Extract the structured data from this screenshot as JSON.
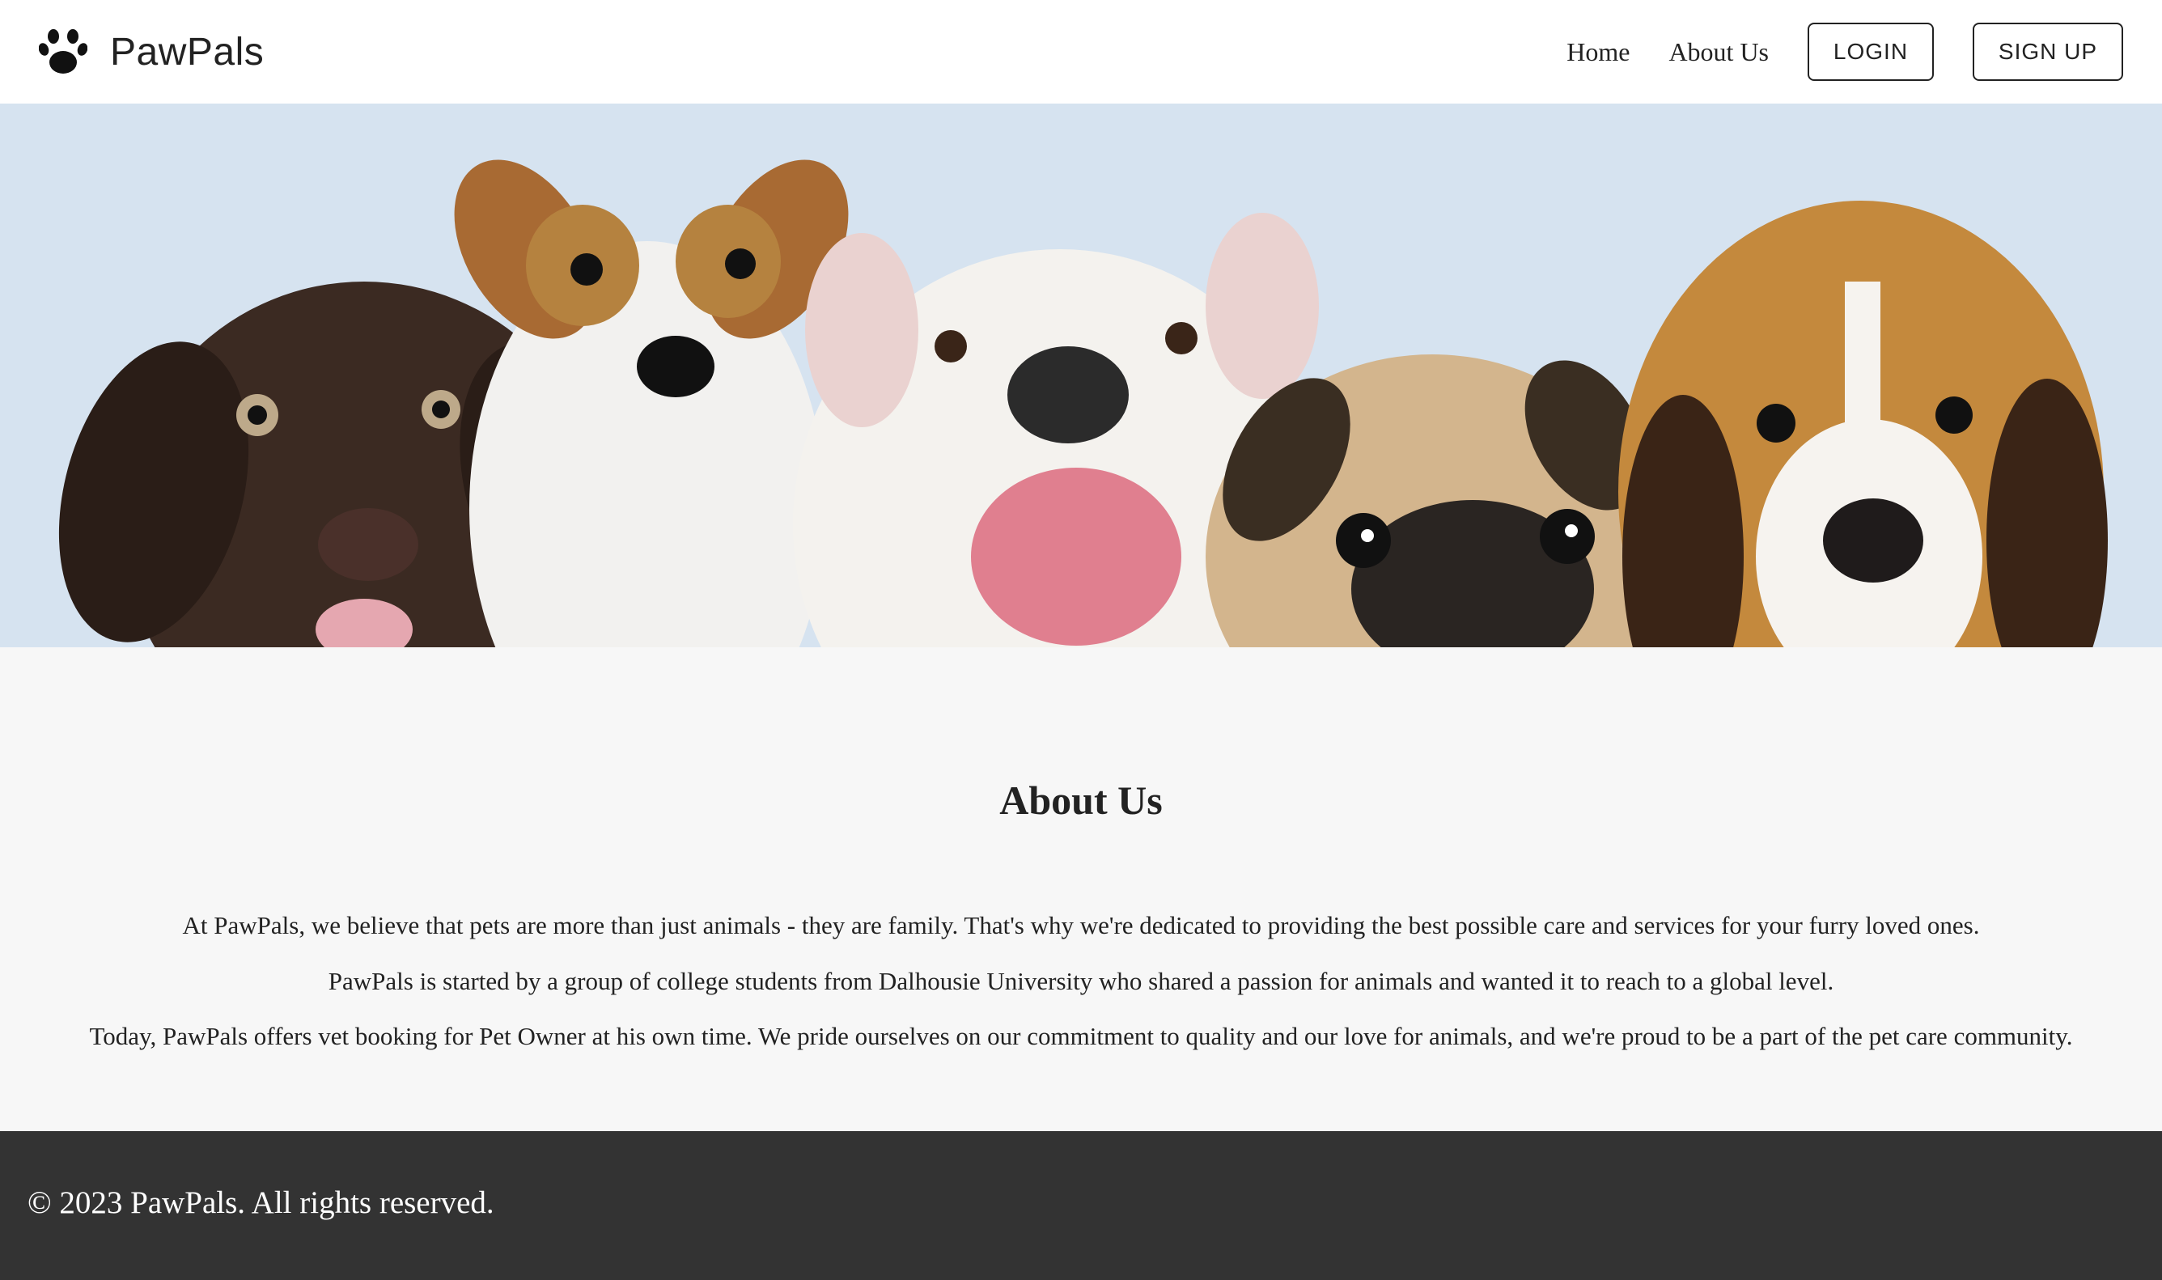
{
  "header": {
    "brand_name": "PawPals",
    "logo_icon": "paw-icon",
    "nav": [
      {
        "label": "Home"
      },
      {
        "label": "About Us"
      }
    ],
    "login_label": "LOGIN",
    "signup_label": "SIGN UP"
  },
  "hero": {
    "image": "banner photo of five puppies (chocolate lab, jack russell, bulldog, pug, beagle) against light blue background"
  },
  "about": {
    "title": "About Us",
    "paragraphs": [
      "At PawPals, we believe that pets are more than just animals - they are family. That's why we're dedicated to providing the best possible care and services for your furry loved ones.",
      "PawPals is started by a group of college students from Dalhousie University who shared a passion for animals and wanted it to reach to a global level.",
      "Today, PawPals offers vet booking for Pet Owner at his own time. We pride ourselves on our commitment to quality and our love for animals, and we're proud to be a part of the pet care community."
    ]
  },
  "footer": {
    "copyright": "© 2023 PawPals. All rights reserved."
  },
  "colors": {
    "header_bg": "#ffffff",
    "hero_bg": "#d6e3f0",
    "content_bg": "#f7f7f7",
    "footer_bg": "#333333",
    "text": "#222222"
  }
}
